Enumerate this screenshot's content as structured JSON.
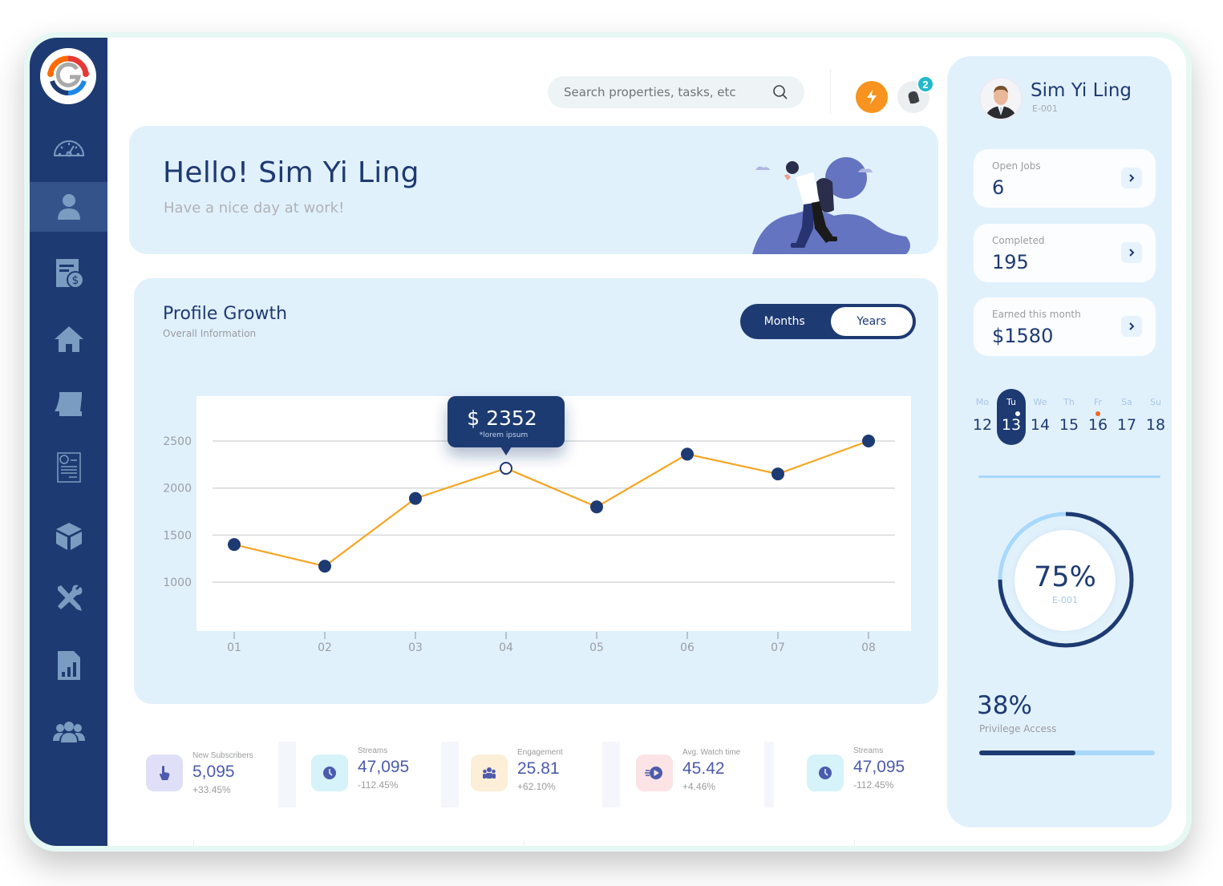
{
  "header": {
    "search_placeholder": "Search properties, tasks, etc",
    "notification_count": "2"
  },
  "sidebar": {
    "items": [
      {
        "name": "dashboard",
        "icon": "speedometer-icon",
        "active": false
      },
      {
        "name": "profile",
        "icon": "user-icon",
        "active": true
      },
      {
        "name": "billing",
        "icon": "receipt-dollar-icon",
        "active": false
      },
      {
        "name": "properties",
        "icon": "home-icon",
        "active": false
      },
      {
        "name": "calendar",
        "icon": "calendar-icon",
        "active": false
      },
      {
        "name": "invoices",
        "icon": "invoice-icon",
        "active": false
      },
      {
        "name": "products",
        "icon": "box-icon",
        "active": false
      },
      {
        "name": "maintenance",
        "icon": "tools-icon",
        "active": false
      },
      {
        "name": "reports",
        "icon": "report-chart-icon",
        "active": false
      },
      {
        "name": "team",
        "icon": "users-icon",
        "active": false
      }
    ]
  },
  "greeting": {
    "title": "Hello! Sim Yi Ling",
    "subtitle": "Have a nice day at work!"
  },
  "profile_growth": {
    "title": "Profile Growth",
    "subtitle": "Overall Information",
    "toggle": {
      "options": [
        "Months",
        "Years"
      ],
      "selected": "Years"
    },
    "tooltip": {
      "value": "$ 2352",
      "note": "*lorem ipsum",
      "point_index": 3
    }
  },
  "chart_data": {
    "type": "line",
    "title": "Profile Growth",
    "xlabel": "",
    "ylabel": "",
    "categories": [
      "01",
      "02",
      "03",
      "04",
      "05",
      "06",
      "07",
      "08"
    ],
    "series": [
      {
        "name": "Profile Growth",
        "values": [
          1400,
          1170,
          1890,
          2210,
          1800,
          2360,
          2150,
          2500
        ]
      }
    ],
    "yticks": [
      1000,
      1500,
      2000,
      2500
    ],
    "ylim": [
      800,
      2700
    ],
    "grid": true,
    "colors": {
      "line": "#f5a623",
      "marker": "#1e3a72"
    }
  },
  "stats": [
    {
      "label": "New Subscribers",
      "value": "5,095",
      "change": "+33.45%",
      "icon": "pointer-hand-icon",
      "bg": "#dfe0f7"
    },
    {
      "label": "Streams",
      "value": "47,095",
      "change": "-112.45%",
      "icon": "clock-icon",
      "bg": "#d6f3f9"
    },
    {
      "label": "Engagement",
      "value": "25.81",
      "change": "+62.10%",
      "icon": "group-icon",
      "bg": "#fdeed8"
    },
    {
      "label": "Avg. Watch time",
      "value": "45.42",
      "change": "+4.46%",
      "icon": "play-fast-icon",
      "bg": "#fce4e6"
    },
    {
      "label": "Streams",
      "value": "47,095",
      "change": "-112.45%",
      "icon": "clock-icon",
      "bg": "#d6f3f9"
    }
  ],
  "user": {
    "name": "Sim Yi Ling",
    "id": "E-001"
  },
  "kpis": [
    {
      "label": "Open Jobs",
      "value": "6"
    },
    {
      "label": "Completed",
      "value": "195"
    },
    {
      "label": "Earned this month",
      "value": "$1580"
    }
  ],
  "week": {
    "days": [
      {
        "name": "Mo",
        "date": "12"
      },
      {
        "name": "Tu",
        "date": "13",
        "selected": true,
        "dot": "#ffffff"
      },
      {
        "name": "We",
        "date": "14"
      },
      {
        "name": "Th",
        "date": "15"
      },
      {
        "name": "Fr",
        "date": "16",
        "dot": "#f26522"
      },
      {
        "name": "Sa",
        "date": "17"
      },
      {
        "name": "Su",
        "date": "18"
      }
    ]
  },
  "progress_ring": {
    "value_label": "75%",
    "value": 0.75,
    "sub": "E-001"
  },
  "privilege": {
    "value_label": "38%",
    "label": "Privilege Access",
    "fill": 0.55
  },
  "colors": {
    "primary": "#1e3a72",
    "accent": "#f7931e",
    "light_bg": "#e1f1fc",
    "badge": "#22b9cc"
  }
}
